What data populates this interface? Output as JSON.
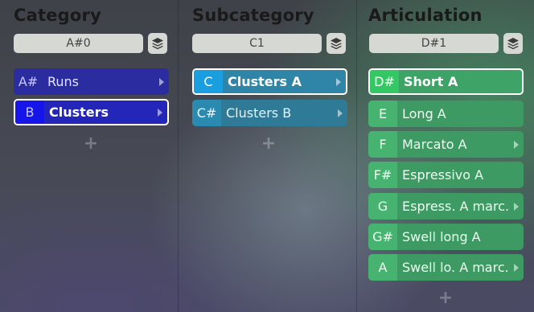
{
  "columns": [
    {
      "title": "Category",
      "key_value": "A#0",
      "items": [
        {
          "key": "A#",
          "label": "Runs",
          "has_children": true,
          "selected": false
        },
        {
          "key": "B",
          "label": "Clusters",
          "has_children": true,
          "selected": true
        }
      ],
      "add_symbol": "+"
    },
    {
      "title": "Subcategory",
      "key_value": "C1",
      "items": [
        {
          "key": "C",
          "label": "Clusters A",
          "has_children": true,
          "selected": true
        },
        {
          "key": "C#",
          "label": "Clusters B",
          "has_children": true,
          "selected": false
        }
      ],
      "add_symbol": "+"
    },
    {
      "title": "Articulation",
      "key_value": "D#1",
      "items": [
        {
          "key": "D#",
          "label": "Short A",
          "has_children": false,
          "selected": true
        },
        {
          "key": "E",
          "label": "Long A",
          "has_children": false,
          "selected": false
        },
        {
          "key": "F",
          "label": "Marcato A",
          "has_children": true,
          "selected": false
        },
        {
          "key": "F#",
          "label": "Espressivo A",
          "has_children": false,
          "selected": false
        },
        {
          "key": "G",
          "label": "Espress. A marc.",
          "has_children": true,
          "selected": false
        },
        {
          "key": "G#",
          "label": "Swell long A",
          "has_children": false,
          "selected": false
        },
        {
          "key": "A",
          "label": "Swell lo. A marc.",
          "has_children": true,
          "selected": false
        }
      ],
      "add_symbol": "+"
    }
  ],
  "icons": {
    "layers": "layers-icon",
    "arrow": "chevron-right-icon",
    "add": "plus-icon"
  },
  "colors": {
    "category": "#2a2ca0",
    "subcategory": "#2f7a96",
    "articulation": "#3d9a62",
    "selected_border": "#ffffff"
  }
}
